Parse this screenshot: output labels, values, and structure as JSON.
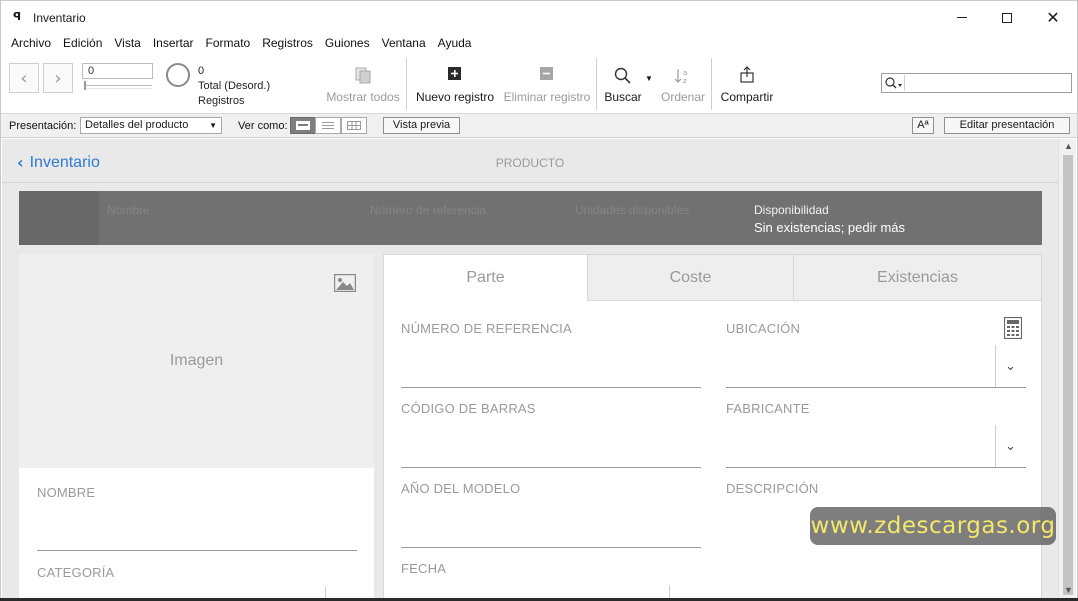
{
  "window": {
    "title": "Inventario"
  },
  "menu": [
    "Archivo",
    "Edición",
    "Vista",
    "Insertar",
    "Formato",
    "Registros",
    "Guiones",
    "Ventana",
    "Ayuda"
  ],
  "toolbar": {
    "record_number": "0",
    "found_count": "0",
    "total_label": "Total (Desord.)",
    "records_label": "Registros",
    "show_all": "Mostrar todos",
    "new_record": "Nuevo registro",
    "delete_record": "Eliminar registro",
    "find": "Buscar",
    "sort": "Ordenar",
    "share": "Compartir",
    "search_value": ""
  },
  "layoutbar": {
    "layout_label": "Presentación:",
    "layout_value": "Detalles del producto",
    "view_as_label": "Ver como:",
    "preview": "Vista previa",
    "font_toggle": "Aª",
    "edit_layout": "Editar presentación"
  },
  "nav": {
    "back_label": "Inventario",
    "page_title": "PRODUCTO"
  },
  "summary": {
    "columns": [
      "Nombre",
      "Número de referencia",
      "Unidades disponibles"
    ],
    "availability_label": "Disponibilidad",
    "availability_value": "Sin existencias; pedir más"
  },
  "left_card": {
    "image_label": "Imagen",
    "fields": [
      "NOMBRE",
      "CATEGORÍA"
    ]
  },
  "tabs": [
    "Parte",
    "Coste",
    "Existencias"
  ],
  "part_fields": {
    "reference_number": "NÚMERO DE REFERENCIA",
    "barcode": "CÓDIGO DE BARRAS",
    "model_year": "AÑO DEL MODELO",
    "date": "FECHA",
    "location": "UBICACIÓN",
    "manufacturer": "FABRICANTE",
    "description": "DESCRIPCIÓN"
  },
  "watermark": "www.zdescargas.org",
  "icons": {
    "app": "filemaker-icon",
    "prev": "chevron-left-icon",
    "next": "chevron-right-icon",
    "show_all": "documents-icon",
    "new_record": "plus-square-icon",
    "delete_record": "minus-square-icon",
    "find": "magnifier-icon",
    "sort": "sort-icon",
    "share": "share-icon",
    "image": "image-icon",
    "calculator": "calculator-icon",
    "back": "chevron-left-icon",
    "dropdown": "chevron-down-icon"
  },
  "colors": {
    "accent": "#2d7bd0",
    "summary_bg": "#717171",
    "watermark_text": "#f3e86a"
  }
}
